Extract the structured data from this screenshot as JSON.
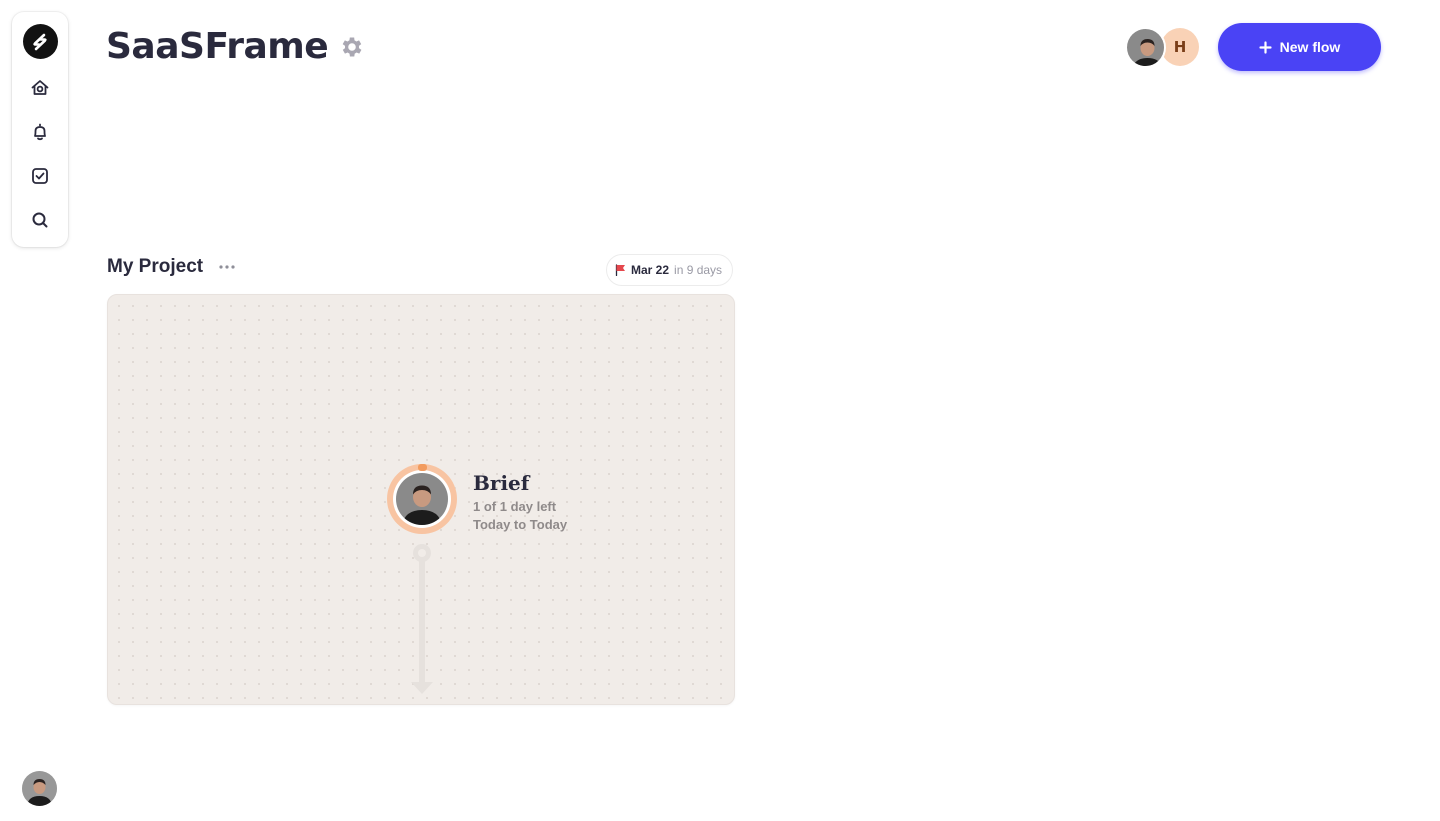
{
  "app": {
    "title": "SaaSFrame"
  },
  "sidebar": {
    "items": [
      {
        "name": "home",
        "icon": "home-icon"
      },
      {
        "name": "notifications",
        "icon": "bell-icon"
      },
      {
        "name": "tasks",
        "icon": "check-square-icon"
      },
      {
        "name": "search",
        "icon": "search-icon"
      }
    ]
  },
  "header": {
    "collaborator_initial": "H",
    "new_flow_label": "New flow"
  },
  "project": {
    "title": "My Project",
    "due_date": "Mar 22",
    "due_relative": "in 9 days"
  },
  "flow": {
    "node_title": "Brief",
    "node_progress": "1 of 1 day left",
    "node_range": "Today to Today"
  },
  "colors": {
    "accent": "#4a43f5",
    "canvas_bg": "#f1ece8",
    "node_ring": "#f8c4a2",
    "flag": "#e5484d"
  }
}
